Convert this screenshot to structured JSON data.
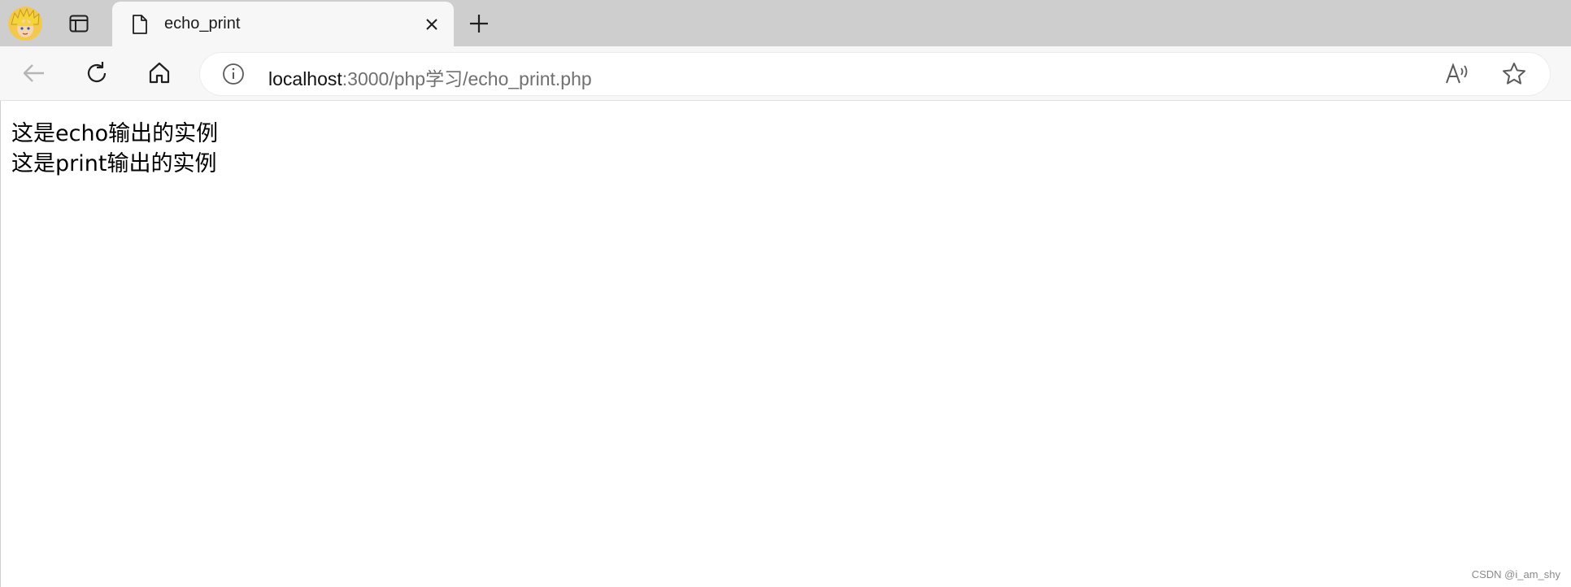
{
  "tab": {
    "title": "echo_print",
    "favicon": "page-icon",
    "close_icon": "close-icon"
  },
  "tabstrip": {
    "profile_icon": "avatar",
    "workspaces_icon": "tab-actions-icon",
    "new_tab_icon": "plus-icon"
  },
  "toolbar": {
    "back_icon": "arrow-left-icon",
    "refresh_icon": "refresh-icon",
    "home_icon": "home-icon",
    "read_aloud_icon": "read-aloud-icon",
    "favorite_icon": "star-icon"
  },
  "address_bar": {
    "info_icon": "info-icon",
    "url_host": "localhost",
    "url_rest": ":3000/php学习/echo_print.php"
  },
  "page": {
    "lines": [
      "这是echo输出的实例",
      "这是print输出的实例"
    ]
  },
  "watermark": "CSDN @i_am_shy",
  "colors": {
    "tabstrip_bg": "#cecece",
    "toolbar_bg": "#f7f7f7",
    "url_host": "#111111",
    "url_path": "#707070"
  }
}
